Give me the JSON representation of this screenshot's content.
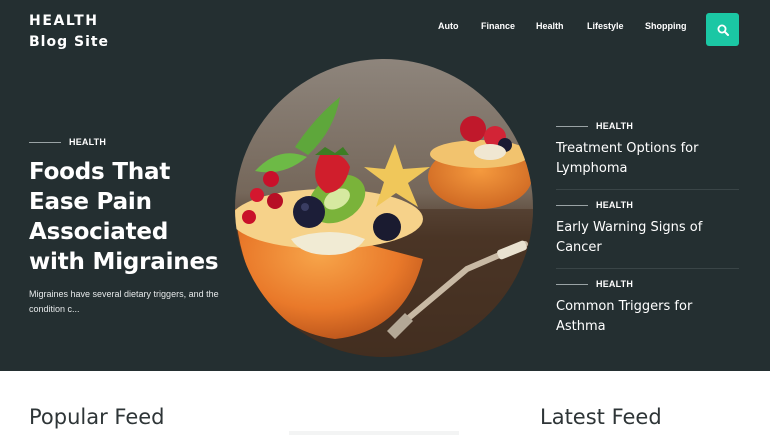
{
  "site": {
    "title_line1": "HEALTH",
    "title_line2": "Blog Site"
  },
  "nav": {
    "items": [
      "Auto",
      "Finance",
      "Health",
      "Lifestyle",
      "Shopping"
    ]
  },
  "search": {
    "icon": "search-icon"
  },
  "featured": {
    "category": "HEALTH",
    "title": "Foods That Ease Pain Associated with Migraines",
    "excerpt": "Migraines have several dietary triggers, and the condition c..."
  },
  "side_posts": [
    {
      "category": "HEALTH",
      "title": "Treatment Options for Lymphoma"
    },
    {
      "category": "HEALTH",
      "title": "Early Warning Signs of Cancer"
    },
    {
      "category": "HEALTH",
      "title": "Common Triggers for Asthma"
    }
  ],
  "sections": {
    "popular": "Popular Feed",
    "latest": "Latest Feed"
  },
  "colors": {
    "hero_bg": "#242f31",
    "accent": "#1bc7a4"
  }
}
